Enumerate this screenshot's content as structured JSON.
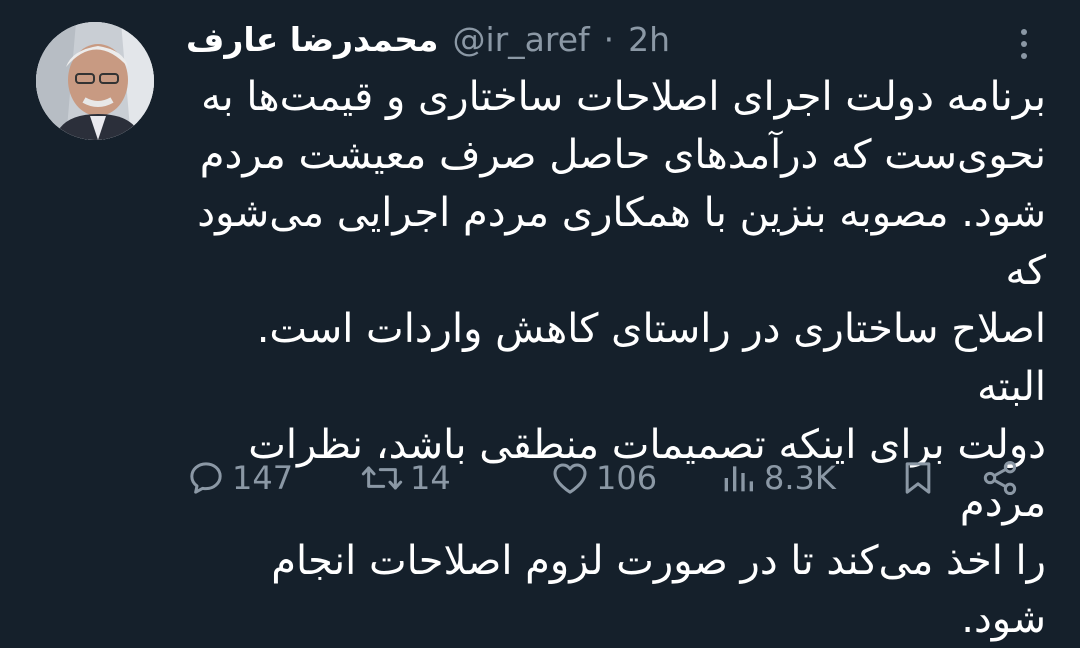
{
  "tweet": {
    "author_name": "محمدرضا عارف",
    "handle": "@ir_aref",
    "separator": "·",
    "time": "2h",
    "text": "برنامه دولت اجرای اصلاحات ساختاری و قیمت‌ها به\nنحوی‌ست که درآمدهای حاصل صرف معیشت مردم\nشود. مصوبه بنزین با همکاری مردم اجرایی می‌شود که\nاصلاح ساختاری در راستای کاهش واردات است. البته\nدولت برای اینکه تصمیمات منطقی باشد، نظرات مردم\nرا اخذ می‌کند تا در صورت لزوم اصلاحات انجام شود."
  },
  "actions": {
    "replies": "147",
    "retweets": "14",
    "likes": "106",
    "views": "8.3K"
  },
  "icons": {
    "reply": "reply-icon",
    "retweet": "retweet-icon",
    "like": "heart-icon",
    "views": "views-icon",
    "bookmark": "bookmark-icon",
    "share": "share-icon",
    "more": "more-icon"
  },
  "colors": {
    "background": "#15202b",
    "text": "#ffffff",
    "secondary": "#8b98a5"
  }
}
